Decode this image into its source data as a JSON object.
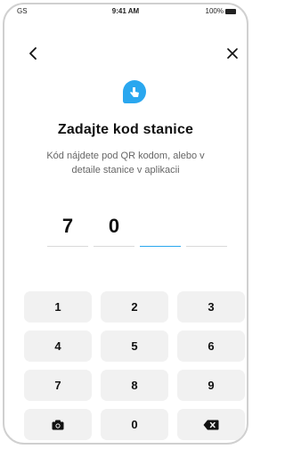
{
  "status": {
    "carrier": "GS",
    "time": "9:41 AM",
    "battery": "100%"
  },
  "nav": {
    "back_icon": "chevron-left-icon",
    "close_icon": "close-icon"
  },
  "header": {
    "logo_icon": "hand-tap-icon",
    "title": "Zadajte kod stanice",
    "subtitle_line1": "Kód nájdete pod QR kodom, alebo v",
    "subtitle_line2": "detaile stanice v aplikacii"
  },
  "code": {
    "digits": [
      "7",
      "0",
      "",
      ""
    ],
    "active_index": 2
  },
  "keypad": {
    "keys": [
      "1",
      "2",
      "3",
      "4",
      "5",
      "6",
      "7",
      "8",
      "9"
    ],
    "zero": "0",
    "camera_icon": "camera-icon",
    "backspace_icon": "backspace-icon"
  },
  "colors": {
    "accent": "#2aa7ef",
    "key_bg": "#f1f1f1"
  }
}
